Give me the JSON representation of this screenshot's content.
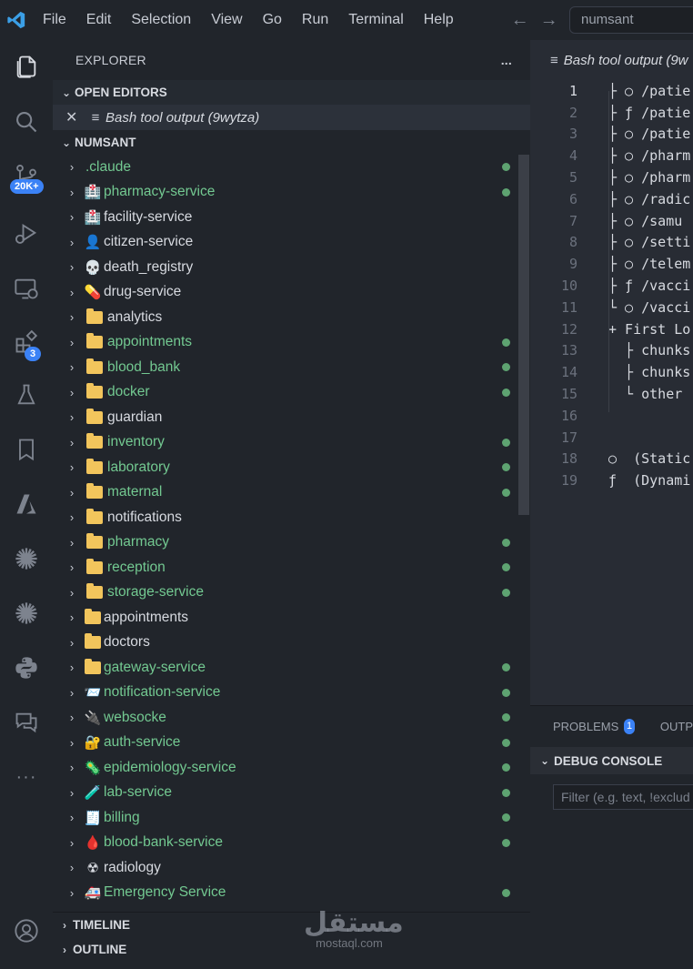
{
  "menu": [
    "File",
    "Edit",
    "Selection",
    "View",
    "Go",
    "Run",
    "Terminal",
    "Help"
  ],
  "command_center": {
    "text": "numsant"
  },
  "activity": {
    "source_control_badge": "20K+",
    "extensions_badge": "3"
  },
  "explorer": {
    "title": "EXPLORER",
    "more": "...",
    "open_editors": {
      "title": "OPEN EDITORS",
      "item": "Bash tool output (9wytza)"
    },
    "workspace_title": "NUMSANT",
    "items": [
      {
        "label": ".claude",
        "icon": "none",
        "color": "green",
        "dot": true
      },
      {
        "label": "pharmacy-service",
        "icon": "🏥",
        "color": "green",
        "dot": true
      },
      {
        "label": "facility-service",
        "icon": "🏥",
        "color": "white",
        "dot": false
      },
      {
        "label": "citizen-service",
        "icon": "👤",
        "color": "white",
        "dot": false
      },
      {
        "label": "death_registry",
        "icon": "💀",
        "color": "white",
        "dot": false
      },
      {
        "label": "drug-service",
        "icon": "💊",
        "color": "white",
        "dot": false
      },
      {
        "label": "analytics",
        "icon": "folder",
        "color": "white",
        "dot": false
      },
      {
        "label": "appointments",
        "icon": "folder",
        "color": "green",
        "dot": true
      },
      {
        "label": "blood_bank",
        "icon": "folder",
        "color": "green",
        "dot": true
      },
      {
        "label": "docker",
        "icon": "folder",
        "color": "green",
        "dot": true
      },
      {
        "label": "guardian",
        "icon": "folder",
        "color": "white",
        "dot": false
      },
      {
        "label": "inventory",
        "icon": "folder",
        "color": "green",
        "dot": true
      },
      {
        "label": "laboratory",
        "icon": "folder",
        "color": "green",
        "dot": true
      },
      {
        "label": "maternal",
        "icon": "folder",
        "color": "green",
        "dot": true
      },
      {
        "label": "notifications",
        "icon": "folder",
        "color": "white",
        "dot": false
      },
      {
        "label": "pharmacy",
        "icon": "folder",
        "color": "green",
        "dot": true
      },
      {
        "label": "reception",
        "icon": "folder",
        "color": "green",
        "dot": true
      },
      {
        "label": "storage-service",
        "icon": "folder",
        "color": "green",
        "dot": true
      },
      {
        "label": "appointments",
        "icon": "folder-tight",
        "color": "white",
        "dot": false
      },
      {
        "label": "doctors",
        "icon": "folder-tight",
        "color": "white",
        "dot": false
      },
      {
        "label": "gateway-service",
        "icon": "folder-tight",
        "color": "green",
        "dot": true
      },
      {
        "label": "notification-service",
        "icon": "📨",
        "color": "green",
        "dot": true
      },
      {
        "label": "websocke",
        "icon": "🔌",
        "color": "green",
        "dot": true
      },
      {
        "label": "auth-service",
        "icon": "🔐",
        "color": "green",
        "dot": true
      },
      {
        "label": "epidemiology-service",
        "icon": "🦠",
        "color": "green",
        "dot": true
      },
      {
        "label": "lab-service",
        "icon": "🧪",
        "color": "green",
        "dot": true
      },
      {
        "label": "billing",
        "icon": "🧾",
        "color": "green",
        "dot": true
      },
      {
        "label": "blood-bank-service",
        "icon": "🩸",
        "color": "green",
        "dot": true
      },
      {
        "label": "radiology",
        "icon": "☢",
        "color": "white",
        "dot": false
      },
      {
        "label": "Emergency Service",
        "icon": "🚑",
        "color": "green",
        "dot": true
      }
    ],
    "timeline": "TIMELINE",
    "outline": "OUTLINE"
  },
  "editor": {
    "tab": "Bash tool output (9w",
    "lines": [
      {
        "n": "1",
        "t": "├ ○ /patie"
      },
      {
        "n": "2",
        "t": "├ ƒ /patie"
      },
      {
        "n": "3",
        "t": "├ ○ /patie"
      },
      {
        "n": "4",
        "t": "├ ○ /pharm"
      },
      {
        "n": "5",
        "t": "├ ○ /pharm"
      },
      {
        "n": "6",
        "t": "├ ○ /radic"
      },
      {
        "n": "7",
        "t": "├ ○ /samu "
      },
      {
        "n": "8",
        "t": "├ ○ /setti"
      },
      {
        "n": "9",
        "t": "├ ○ /telem"
      },
      {
        "n": "10",
        "t": "├ ƒ /vacci"
      },
      {
        "n": "11",
        "t": "└ ○ /vacci"
      },
      {
        "n": "12",
        "t": "+ First Lo"
      },
      {
        "n": "13",
        "t": "  ├ chunks"
      },
      {
        "n": "14",
        "t": "  ├ chunks"
      },
      {
        "n": "15",
        "t": "  └ other "
      },
      {
        "n": "16",
        "t": ""
      },
      {
        "n": "17",
        "t": ""
      },
      {
        "n": "18",
        "t": "○  (Static"
      },
      {
        "n": "19",
        "t": "ƒ  (Dynami"
      }
    ]
  },
  "panel": {
    "problems": "PROBLEMS",
    "problems_count": "1",
    "output": "OUTP",
    "debug_console": "DEBUG CONSOLE",
    "filter_placeholder": "Filter (e.g. text, !exclud"
  },
  "watermark": {
    "arabic": "مستقل",
    "latin": "mostaql.com"
  }
}
